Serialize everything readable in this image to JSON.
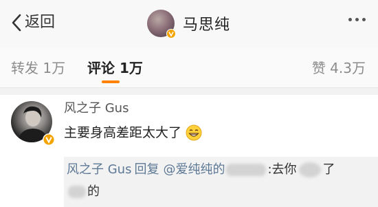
{
  "nav": {
    "back_label": "返回",
    "title": "马思纯"
  },
  "tabs": {
    "repost": "转发 1万",
    "comments": "评论 1万",
    "likes": "赞 4.3万"
  },
  "comment": {
    "username": "风之子 Gus",
    "text": "主要身高差距太大了",
    "emoji": "grinning-emoji",
    "reply": {
      "user": "风之子 Gus",
      "verb": "回复",
      "mention": "@爱纯纯的",
      "text_part1": ":去你",
      "text_part2": "了",
      "text_part3": "的"
    }
  },
  "colors": {
    "accent": "#ff8200",
    "link": "#5d7895",
    "verified_badge": "#f4a400"
  }
}
